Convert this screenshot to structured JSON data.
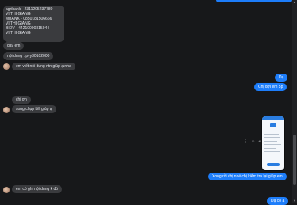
{
  "messages": {
    "m1": [
      "agribank - 2311205237780",
      "VI THI GIANG",
      "MBANK - 0850181506666",
      "VI THI GIANG",
      "BIDV - 44210000315944",
      "VI THI GIANG"
    ],
    "m2": "dạy em",
    "m3": "nội dung : pvy30102000",
    "m4": "em viết nội dung ntn giúp ạ nha",
    "m5": "Dạ",
    "m6": "Chị đợi em 5p",
    "m7": "chị ơn",
    "m8": "song chụp bill giúp ạ",
    "m9": "Xong rồi chị nhé chị kiểm tra lại giúp em",
    "m10": "em có ghi nội dung k đó",
    "m11": "Dạ có ạ"
  },
  "icons": {
    "more": "⋮",
    "emoji": "☺",
    "reply": "↩"
  },
  "colors": {
    "background": "#17181a",
    "incoming": "#3a3b3e",
    "outgoing": "#1d7dfa"
  }
}
